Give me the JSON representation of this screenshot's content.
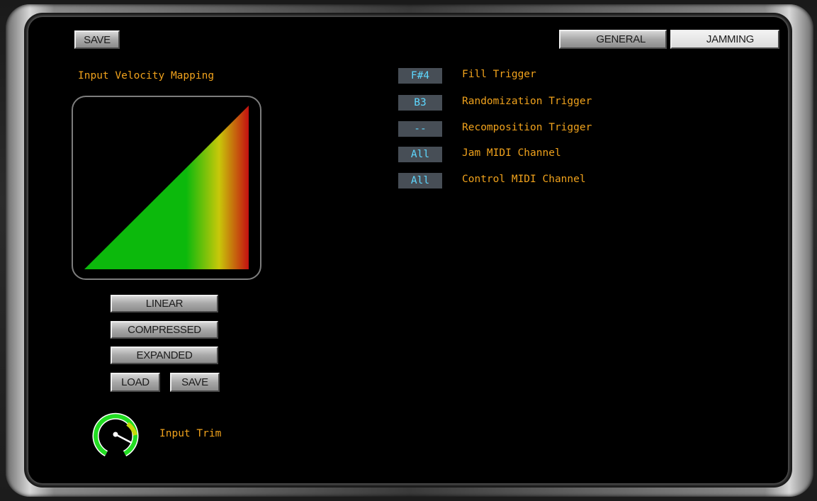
{
  "header": {
    "save_label": "SAVE",
    "tabs": [
      {
        "label": "GENERAL",
        "active": false
      },
      {
        "label": "JAMMING",
        "active": true
      }
    ]
  },
  "velocity": {
    "title": "Input Velocity Mapping",
    "buttons": {
      "linear": "LINEAR",
      "compressed": "COMPRESSED",
      "expanded": "EXPANDED",
      "load": "LOAD",
      "save": "SAVE"
    },
    "gradient_colors": [
      "#0cb90c",
      "#c8c80a",
      "#c41010"
    ]
  },
  "trim": {
    "label": "Input Trim",
    "icon": "input-trim-knob-icon",
    "accent": "#22dd22"
  },
  "triggers": [
    {
      "value": "F#4",
      "label": "Fill Trigger"
    },
    {
      "value": "B3",
      "label": "Randomization Trigger"
    },
    {
      "value": "--",
      "label": "Recomposition Trigger"
    },
    {
      "value": "All",
      "label": "Jam MIDI Channel"
    },
    {
      "value": "All",
      "label": "Control MIDI Channel"
    }
  ],
  "colors": {
    "label": "#f0a21c",
    "value_text": "#5ed8ff",
    "value_bg": "#474e56"
  }
}
